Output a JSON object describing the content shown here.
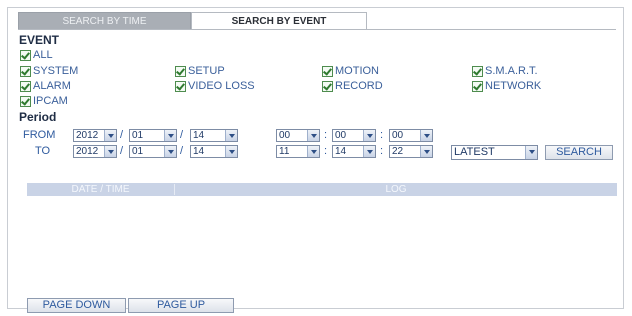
{
  "tabs": [
    {
      "label": "SEARCH BY TIME",
      "active": false
    },
    {
      "label": "SEARCH BY EVENT",
      "active": true
    }
  ],
  "event": {
    "title": "EVENT",
    "items": [
      {
        "label": "ALL",
        "checked": true
      },
      {
        "label": "SYSTEM",
        "checked": true
      },
      {
        "label": "SETUP",
        "checked": true
      },
      {
        "label": "MOTION",
        "checked": true
      },
      {
        "label": "S.M.A.R.T.",
        "checked": true
      },
      {
        "label": "ALARM",
        "checked": true
      },
      {
        "label": "VIDEO LOSS",
        "checked": true
      },
      {
        "label": "RECORD",
        "checked": true
      },
      {
        "label": "NETWORK",
        "checked": true
      },
      {
        "label": "IPCAM",
        "checked": true
      }
    ]
  },
  "period": {
    "title": "Period",
    "from": {
      "label": "FROM",
      "year": "2012",
      "month": "01",
      "day": "14",
      "hour": "00",
      "minute": "00",
      "second": "00"
    },
    "to": {
      "label": "TO",
      "year": "2012",
      "month": "01",
      "day": "14",
      "hour": "11",
      "minute": "14",
      "second": "22"
    },
    "date_sep": "/",
    "time_sep": ":",
    "order": "LATEST",
    "search_label": "SEARCH"
  },
  "table": {
    "columns": [
      "DATE / TIME",
      "LOG"
    ],
    "rows": []
  },
  "pager": {
    "page_down": "PAGE DOWN",
    "page_up": "PAGE UP"
  },
  "colors": {
    "accent": "#2e5a9e",
    "header_bg": "#c9d3e6",
    "inactive_tab": "#a9aeb5"
  }
}
